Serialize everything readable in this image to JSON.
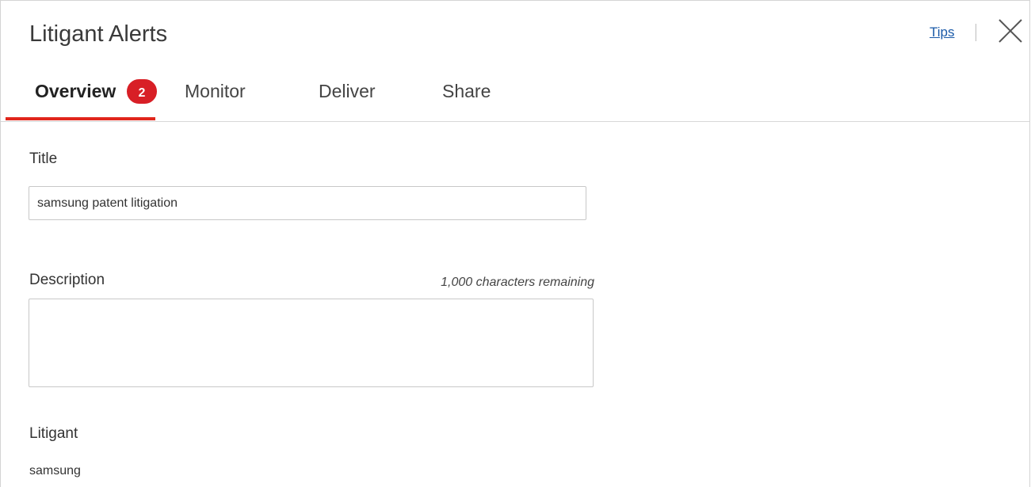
{
  "dialog": {
    "title": "Litigant Alerts",
    "tips_label": "Tips"
  },
  "tabs": [
    {
      "label": "Overview",
      "active": true
    },
    {
      "label": "Monitor",
      "active": false
    },
    {
      "label": "Deliver",
      "active": false
    },
    {
      "label": "Share",
      "active": false
    }
  ],
  "step_badge": "2",
  "form": {
    "title_label": "Title",
    "title_value": "samsung patent litigation",
    "description_label": "Description",
    "description_remaining": "1,000 characters remaining",
    "description_value": "",
    "litigant_label": "Litigant",
    "litigant_value": "samsung"
  },
  "icons": {
    "close": "close-icon"
  },
  "colors": {
    "accent": "#e1261c",
    "badge": "#d81f26",
    "link": "#1a5aa8"
  }
}
